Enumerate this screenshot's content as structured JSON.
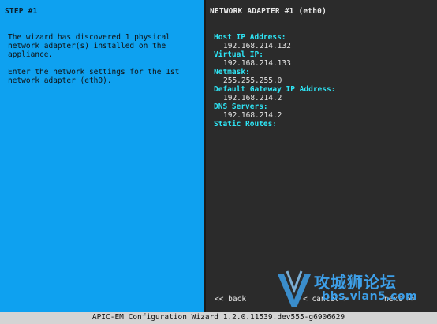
{
  "left": {
    "title": "STEP #1",
    "paragraph1": "The wizard has discovered 1 physical\nnetwork adapter(s) installed on the\nappliance.",
    "paragraph2": "Enter the network settings for the 1st\nnetwork adapter (eth0)."
  },
  "right": {
    "title": "NETWORK ADAPTER #1 (eth0)",
    "fields": [
      {
        "label": "Host IP Address:",
        "value": "192.168.214.132"
      },
      {
        "label": "Virtual IP:",
        "value": "192.168.214.133"
      },
      {
        "label": "Netmask:",
        "value": "255.255.255.0"
      },
      {
        "label": "Default Gateway IP Address:",
        "value": "192.168.214.2"
      },
      {
        "label": "DNS Servers:",
        "value": "192.168.214.2"
      },
      {
        "label": "Static Routes:",
        "value": ""
      }
    ]
  },
  "buttons": {
    "back": "<< back",
    "cancel": "< cancel >",
    "next": "next >>"
  },
  "status_bar": "APIC-EM Configuration Wizard 1.2.0.11539.dev555-g6906629",
  "watermark": {
    "text_cn": "攻城狮论坛",
    "url": "bbs.vlan5.com"
  },
  "colors": {
    "left_bg": "#0ea1f0",
    "right_bg": "#2b2b2b",
    "label": "#2ee5f5"
  }
}
